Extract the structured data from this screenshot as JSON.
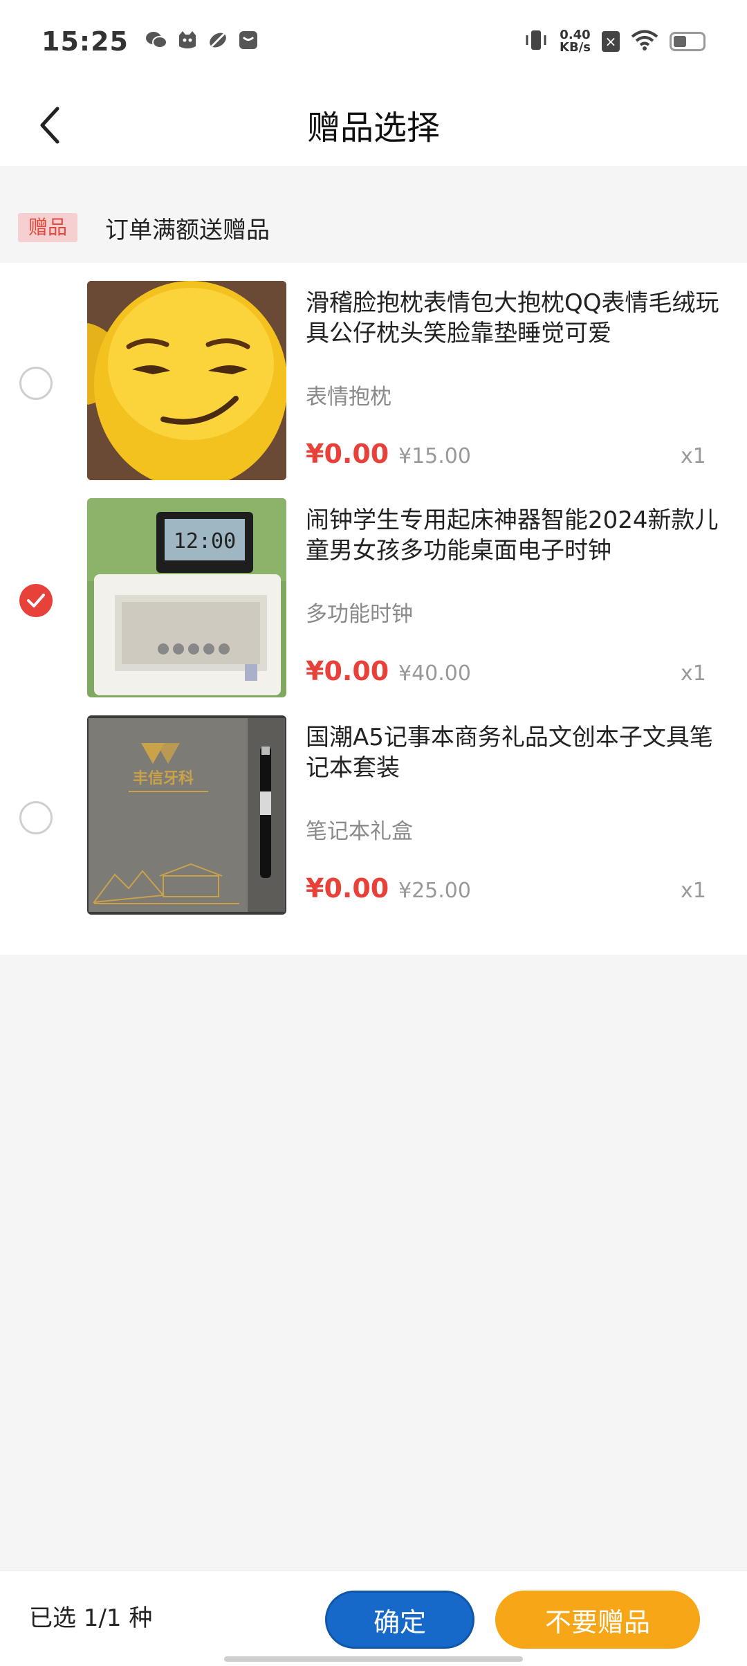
{
  "status_bar": {
    "time": "15:25",
    "net_speed_value": "0.40",
    "net_speed_unit": "KB/s",
    "x_badge": "×",
    "icons": [
      "wechat-icon",
      "cat-app-icon",
      "leaf-app-icon",
      "message-app-icon",
      "vibrate-icon",
      "wifi-icon",
      "battery-icon"
    ]
  },
  "header": {
    "title": "赠品选择",
    "back_icon": "chevron-left-icon"
  },
  "promo": {
    "tag": "赠品",
    "text": "订单满额送赠品"
  },
  "items": [
    {
      "title": "滑稽脸抱枕表情包大抱枕QQ表情毛绒玩具公仔枕头笑脸靠垫睡觉可爱",
      "spec": "表情抱枕",
      "price": "¥0.00",
      "original_price": "¥15.00",
      "qty": "x1",
      "selected": false,
      "thumb_icon": "smiley-pillow-image"
    },
    {
      "title": "闹钟学生专用起床神器智能2024新款儿童男女孩多功能桌面电子时钟",
      "spec": "多功能时钟",
      "price": "¥0.00",
      "original_price": "¥40.00",
      "qty": "x1",
      "selected": true,
      "thumb_icon": "alarm-clock-image",
      "clock_display": "12:00"
    },
    {
      "title": "国潮A5记事本商务礼品文创本子文具笔记本套装",
      "spec": "笔记本礼盒",
      "price": "¥0.00",
      "original_price": "¥25.00",
      "qty": "x1",
      "selected": false,
      "thumb_icon": "notebook-giftbox-image",
      "brand_text": "丰信牙科"
    }
  ],
  "footer": {
    "selected_text": "已选 1/1 种",
    "confirm_label": "确定",
    "no_gift_label": "不要赠品"
  },
  "colors": {
    "accent_red": "#e8413a",
    "confirm_blue": "#1769c9",
    "no_gift_orange": "#f6a616",
    "tag_bg": "#f6cfd0"
  }
}
